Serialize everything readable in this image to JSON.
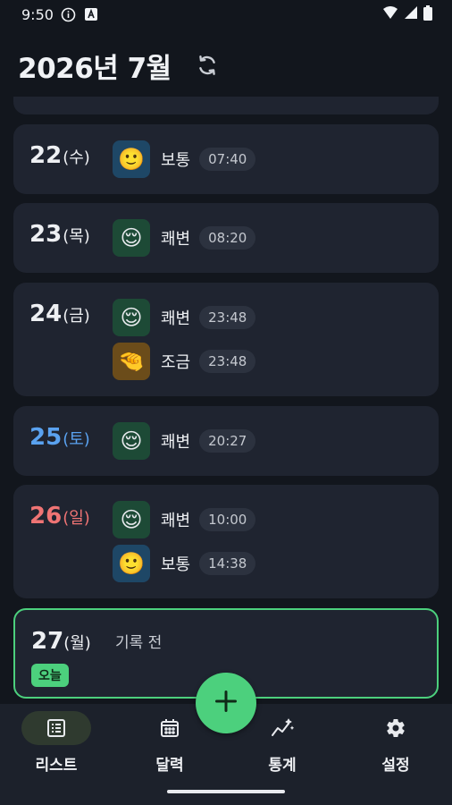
{
  "status_bar": {
    "time": "9:50",
    "icons": [
      "info-icon",
      "a-icon",
      "wifi-icon",
      "signal-icon",
      "battery-icon"
    ]
  },
  "header": {
    "title": "2026년 7월",
    "refresh_icon": "refresh-icon"
  },
  "days": [
    {
      "day": "22",
      "dow": "(수)",
      "entries": [
        {
          "emoji": "🙂",
          "label": "보통",
          "time": "07:40",
          "kind": "normal"
        }
      ]
    },
    {
      "day": "23",
      "dow": "(목)",
      "entries": [
        {
          "emoji": "😌",
          "label": "쾌변",
          "time": "08:20",
          "kind": "good"
        }
      ]
    },
    {
      "day": "24",
      "dow": "(금)",
      "entries": [
        {
          "emoji": "😌",
          "label": "쾌변",
          "time": "23:48",
          "kind": "good"
        },
        {
          "emoji": "🤏",
          "label": "조금",
          "time": "23:48",
          "kind": "little"
        }
      ]
    },
    {
      "day": "25",
      "dow": "(토)",
      "entries": [
        {
          "emoji": "😌",
          "label": "쾌변",
          "time": "20:27",
          "kind": "good"
        }
      ]
    },
    {
      "day": "26",
      "dow": "(일)",
      "entries": [
        {
          "emoji": "😌",
          "label": "쾌변",
          "time": "10:00",
          "kind": "good"
        },
        {
          "emoji": "🙂",
          "label": "보통",
          "time": "14:38",
          "kind": "normal"
        }
      ]
    }
  ],
  "today": {
    "day": "27",
    "dow": "(월)",
    "pending_text": "기록 전",
    "badge": "오늘"
  },
  "fab_icon": "plus-icon",
  "nav": {
    "items": [
      {
        "label": "리스트",
        "icon": "list-icon",
        "active": true
      },
      {
        "label": "달력",
        "icon": "calendar-icon",
        "active": false
      },
      {
        "label": "통계",
        "icon": "stats-icon",
        "active": false
      },
      {
        "label": "설정",
        "icon": "gear-icon",
        "active": false
      }
    ]
  },
  "colors": {
    "accent": "#4cd07d",
    "saturday": "#5aa2f0",
    "sunday": "#ef7474"
  }
}
